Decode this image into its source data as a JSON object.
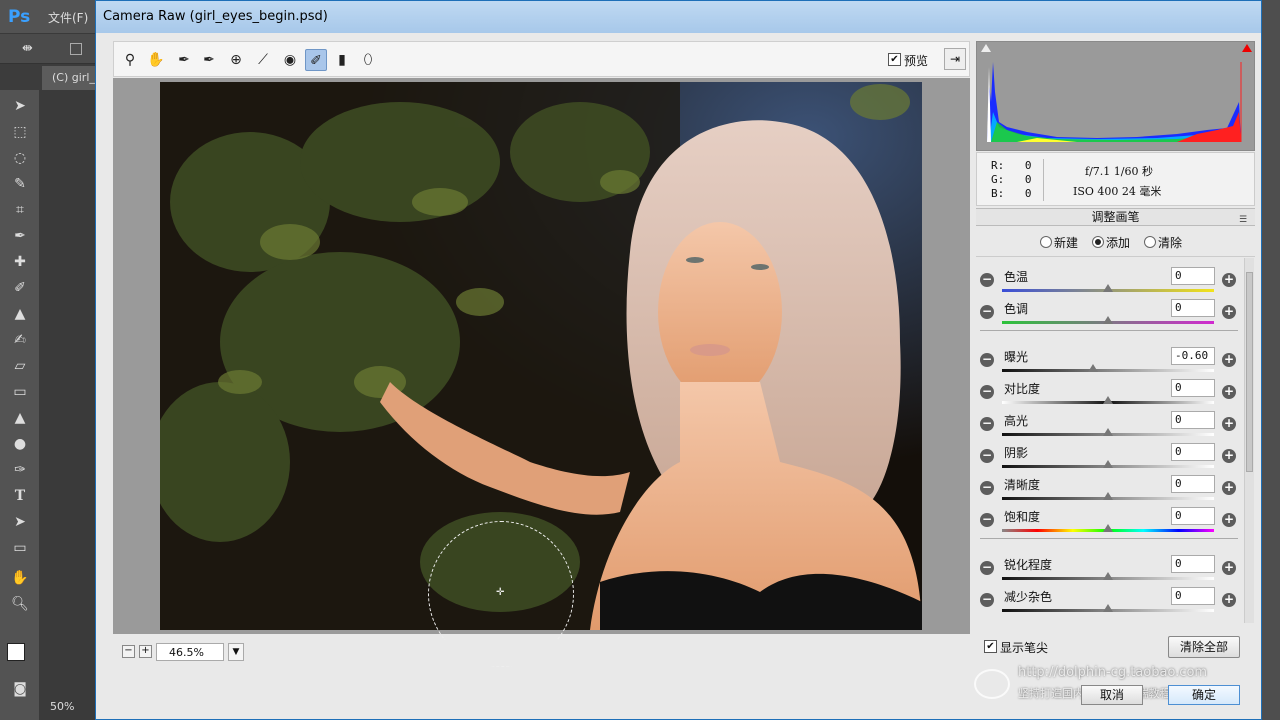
{
  "photoshop": {
    "logo": "Ps",
    "menu_file": "文件(F)",
    "doc_tab": "(C) girl_",
    "zoom_level": "50%"
  },
  "dialog": {
    "title": "Camera Raw (girl_eyes_begin.psd)",
    "preview_label": "预览",
    "preview_checked": true,
    "zoom_value": "46.5%",
    "histogram": {
      "r_label": "R:",
      "r_value": "0",
      "g_label": "G:",
      "g_value": "0",
      "b_label": "B:",
      "b_value": "0",
      "exposure_info": "f/7.1   1/60 秒",
      "iso_info": "ISO 400   24 毫米"
    },
    "panel": {
      "title": "调整画笔",
      "modes": [
        "新建",
        "添加",
        "清除"
      ],
      "selected_mode": "添加",
      "sliders": [
        {
          "label": "色温",
          "value": "0",
          "level": 0.5
        },
        {
          "label": "色调",
          "value": "0",
          "level": 0.5
        },
        {
          "label": "曝光",
          "value": "-0.60",
          "level": 0.43
        },
        {
          "label": "对比度",
          "value": "0",
          "level": 0.5
        },
        {
          "label": "高光",
          "value": "0",
          "level": 0.5
        },
        {
          "label": "阴影",
          "value": "0",
          "level": 0.5
        },
        {
          "label": "清晰度",
          "value": "0",
          "level": 0.5
        },
        {
          "label": "饱和度",
          "value": "0",
          "level": 0.5
        },
        {
          "label": "锐化程度",
          "value": "0",
          "level": 0.5
        },
        {
          "label": "减少杂色",
          "value": "0",
          "level": 0.5
        }
      ],
      "show_tip_label": "显示笔尖",
      "show_tip_checked": true,
      "clear_all_label": "清除全部"
    },
    "cancel_label": "取消",
    "ok_label": "确定"
  },
  "watermark": {
    "line1": "http://dolphin-cg.taobao.com",
    "line2": "坚持打造国内PC/MAC高端教程"
  },
  "colors": {
    "accent": "#1d6fb8",
    "title_bar": "#a7c8ea"
  }
}
